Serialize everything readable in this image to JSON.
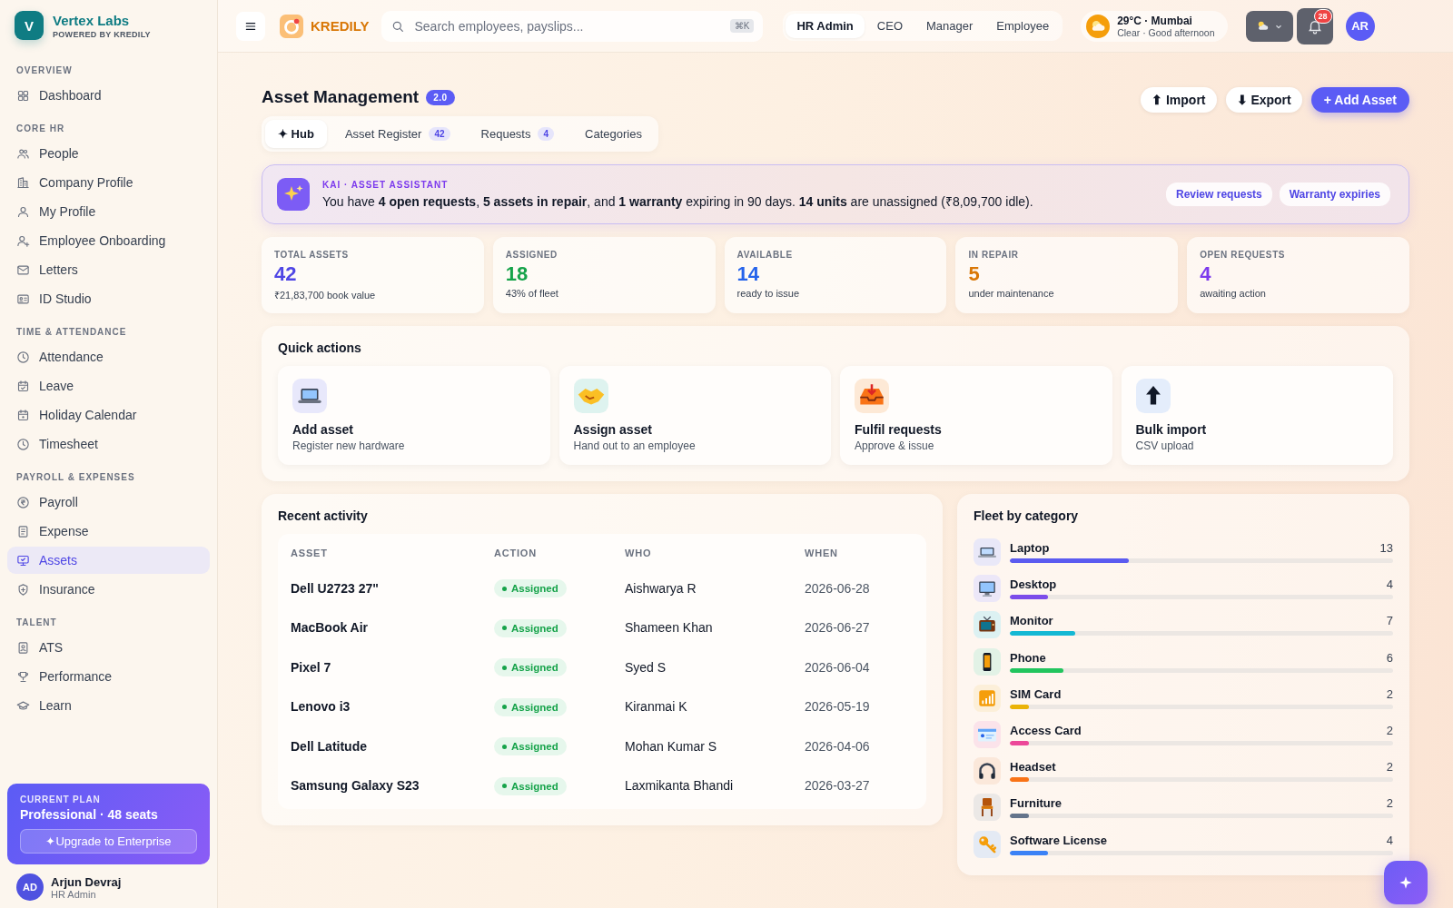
{
  "sidebar": {
    "brand": {
      "initial": "V",
      "name": "Vertex Labs",
      "tagline": "POWERED BY KREDILY"
    },
    "sections": [
      {
        "heading": "OVERVIEW",
        "items": [
          {
            "label": "Dashboard",
            "selected": false
          }
        ]
      },
      {
        "heading": "CORE HR",
        "items": [
          {
            "label": "People",
            "selected": false
          },
          {
            "label": "Company Profile",
            "selected": false
          },
          {
            "label": "My Profile",
            "selected": false
          },
          {
            "label": "Employee Onboarding",
            "selected": false
          },
          {
            "label": "Letters",
            "selected": false
          },
          {
            "label": "ID Studio",
            "selected": false
          }
        ]
      },
      {
        "heading": "TIME & ATTENDANCE",
        "items": [
          {
            "label": "Attendance",
            "selected": false
          },
          {
            "label": "Leave",
            "selected": false
          },
          {
            "label": "Holiday Calendar",
            "selected": false
          },
          {
            "label": "Timesheet",
            "selected": false
          }
        ]
      },
      {
        "heading": "PAYROLL & EXPENSES",
        "items": [
          {
            "label": "Payroll",
            "selected": false
          },
          {
            "label": "Expense",
            "selected": false
          },
          {
            "label": "Assets",
            "selected": true
          },
          {
            "label": "Insurance",
            "selected": false
          }
        ]
      },
      {
        "heading": "TALENT",
        "items": [
          {
            "label": "ATS",
            "selected": false
          },
          {
            "label": "Performance",
            "selected": false
          },
          {
            "label": "Learn",
            "selected": false
          }
        ]
      }
    ],
    "plan": {
      "label": "CURRENT PLAN",
      "name": "Professional · 48 seats",
      "button": "✦Upgrade to Enterprise"
    },
    "user": {
      "initials": "AD",
      "name": "Arjun Devraj",
      "role": "HR Admin"
    }
  },
  "topbar": {
    "logo": "KREDILY",
    "search": {
      "placeholder": "Search employees, payslips...",
      "shortcut": "⌘K"
    },
    "roles": [
      {
        "label": "HR Admin",
        "selected": true
      },
      {
        "label": "CEO",
        "selected": false
      },
      {
        "label": "Manager",
        "selected": false
      },
      {
        "label": "Employee",
        "selected": false
      }
    ],
    "weather": {
      "title": "29°C · Mumbai",
      "subtitle": "Clear · Good afternoon"
    },
    "notifications": "28",
    "avatar": "AR"
  },
  "page": {
    "title": "Asset Management",
    "version": "2.0",
    "actions": [
      {
        "label": "⬆ Import",
        "kind": "secondary"
      },
      {
        "label": "⬇ Export",
        "kind": "secondary"
      },
      {
        "label": "+ Add Asset",
        "kind": "primary"
      }
    ],
    "tabs": [
      {
        "label": "✦ Hub",
        "selected": true
      },
      {
        "label": "Asset Register",
        "count": "42",
        "selected": false
      },
      {
        "label": "Requests",
        "count": "4",
        "selected": false
      },
      {
        "label": "Categories",
        "selected": false
      }
    ]
  },
  "assistant": {
    "label": "KAI · ASSET ASSISTANT",
    "message": "You have **4 open requests**, **5 assets in repair**, and **1 warranty** expiring in 90 days. **14 units** are unassigned (₹8,09,700 idle).",
    "buttons": [
      "Review requests",
      "Warranty expiries"
    ]
  },
  "stats": [
    {
      "label": "TOTAL ASSETS",
      "value": "42",
      "sub": "₹21,83,700 book value",
      "color": "#4f46e5"
    },
    {
      "label": "ASSIGNED",
      "value": "18",
      "sub": "43% of fleet",
      "color": "#16a34a"
    },
    {
      "label": "AVAILABLE",
      "value": "14",
      "sub": "ready to issue",
      "color": "#2563eb"
    },
    {
      "label": "IN REPAIR",
      "value": "5",
      "sub": "under maintenance",
      "color": "#d97706"
    },
    {
      "label": "OPEN REQUESTS",
      "value": "4",
      "sub": "awaiting action",
      "color": "#7c3aed"
    }
  ],
  "quick_actions": {
    "title": "Quick actions",
    "items": [
      {
        "title": "Add asset",
        "subtitle": "Register new hardware"
      },
      {
        "title": "Assign asset",
        "subtitle": "Hand out to an employee"
      },
      {
        "title": "Fulfil requests",
        "subtitle": "Approve & issue"
      },
      {
        "title": "Bulk import",
        "subtitle": "CSV upload"
      }
    ]
  },
  "recent_activity": {
    "title": "Recent activity",
    "columns": [
      "ASSET",
      "ACTION",
      "WHO",
      "WHEN"
    ],
    "rows": [
      {
        "asset": "Dell U2723 27\"",
        "action": "Assigned",
        "who": "Aishwarya R",
        "when": "2026-06-28"
      },
      {
        "asset": "MacBook Air",
        "action": "Assigned",
        "who": "Shameen Khan",
        "when": "2026-06-27"
      },
      {
        "asset": "Pixel 7",
        "action": "Assigned",
        "who": "Syed S",
        "when": "2026-06-04"
      },
      {
        "asset": "Lenovo i3",
        "action": "Assigned",
        "who": "Kiranmai K",
        "when": "2026-05-19"
      },
      {
        "asset": "Dell Latitude",
        "action": "Assigned",
        "who": "Mohan Kumar S",
        "when": "2026-04-06"
      },
      {
        "asset": "Samsung Galaxy S23",
        "action": "Assigned",
        "who": "Laxmikanta Bhandi",
        "when": "2026-03-27"
      }
    ]
  },
  "fleet": {
    "title": "Fleet by category",
    "items": [
      {
        "name": "Laptop",
        "count": "13",
        "level": 0.31,
        "color": "#5b5bf0"
      },
      {
        "name": "Desktop",
        "count": "4",
        "level": 0.1,
        "color": "#7c4dea"
      },
      {
        "name": "Monitor",
        "count": "7",
        "level": 0.17,
        "color": "#14b8d4"
      },
      {
        "name": "Phone",
        "count": "6",
        "level": 0.14,
        "color": "#22c55e"
      },
      {
        "name": "SIM Card",
        "count": "2",
        "level": 0.05,
        "color": "#eab308"
      },
      {
        "name": "Access Card",
        "count": "2",
        "level": 0.05,
        "color": "#ec4899"
      },
      {
        "name": "Headset",
        "count": "2",
        "level": 0.05,
        "color": "#f97316"
      },
      {
        "name": "Furniture",
        "count": "2",
        "level": 0.05,
        "color": "#64748b"
      },
      {
        "name": "Software License",
        "count": "4",
        "level": 0.1,
        "color": "#3b82f6"
      }
    ]
  }
}
